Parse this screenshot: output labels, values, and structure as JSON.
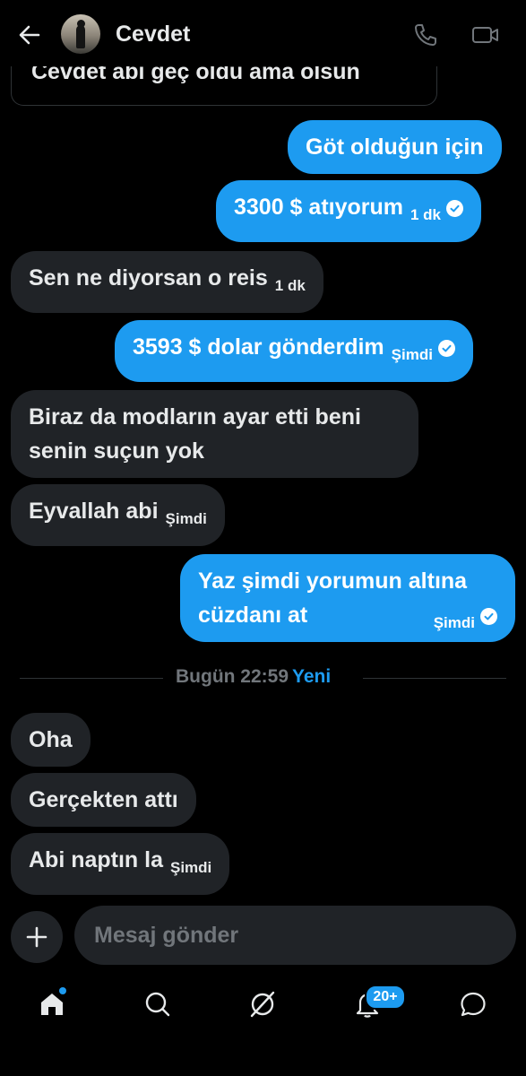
{
  "header": {
    "contact_name": "Cevdet"
  },
  "quoted_message": "Cevdet abi geç oldu ama olsun",
  "messages": [
    {
      "text": "Göt olduğun için",
      "time": ""
    },
    {
      "text": "3300 $ atıyorum",
      "time": "1 dk"
    },
    {
      "text": "Sen ne diyorsan o reis",
      "time": "1 dk"
    },
    {
      "text": "3593 $ dolar gönderdim",
      "time": "Şimdi"
    },
    {
      "line1": "Biraz da modların ayar etti beni",
      "line2": "senin suçun yok"
    },
    {
      "text": "Eyvallah abi",
      "time": "Şimdi"
    },
    {
      "line1": "Yaz şimdi yorumun altına",
      "line2": "cüzdanı at",
      "time": "Şimdi"
    },
    {
      "text": "Oha"
    },
    {
      "text": "Gerçekten attı"
    },
    {
      "text": "Abi naptın la",
      "time": "Şimdi"
    }
  ],
  "divider": {
    "time": "Bugün 22:59",
    "new_label": "Yeni"
  },
  "composer": {
    "placeholder": "Mesaj gönder"
  },
  "nav": {
    "notifications_badge": "20+"
  },
  "colors": {
    "accent": "#1d9bf0",
    "incoming_bubble": "#202327",
    "background": "#000000"
  }
}
